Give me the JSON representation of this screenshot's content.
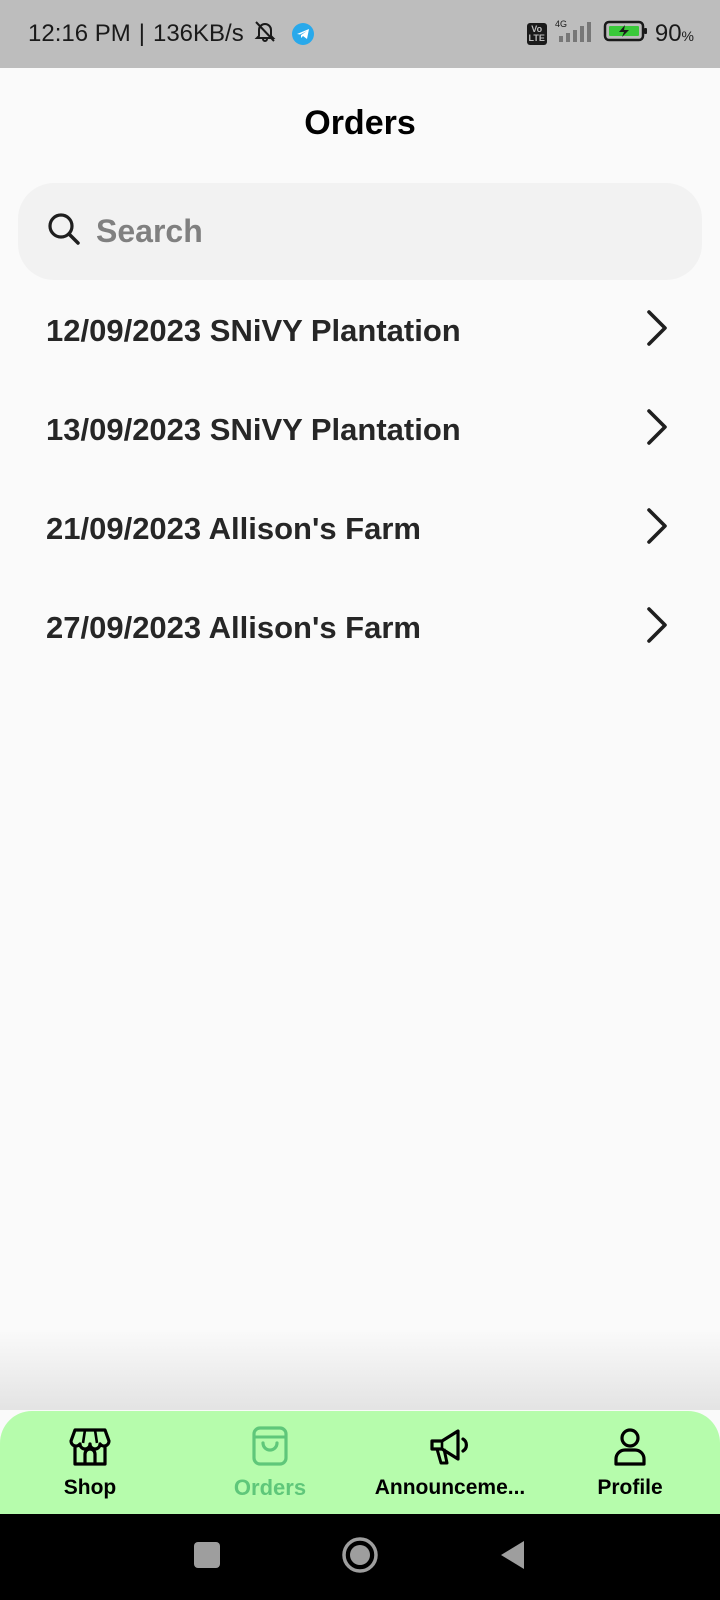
{
  "status_bar": {
    "time": "12:16 PM",
    "speed": "136KB/s",
    "network": "4G",
    "volte": "Vo\nLTE",
    "battery_percent": "90",
    "battery_unit": "%"
  },
  "header": {
    "title": "Orders"
  },
  "search": {
    "placeholder": "Search",
    "value": ""
  },
  "orders": [
    {
      "label": "12/09/2023 SNiVY Plantation"
    },
    {
      "label": "13/09/2023 SNiVY Plantation"
    },
    {
      "label": "21/09/2023 Allison's Farm"
    },
    {
      "label": "27/09/2023 Allison's Farm"
    }
  ],
  "bottom_nav": {
    "items": [
      {
        "label": "Shop",
        "icon": "shop-icon",
        "active": false
      },
      {
        "label": "Orders",
        "icon": "shopping-bag-icon",
        "active": true
      },
      {
        "label": "Announceme...",
        "icon": "megaphone-icon",
        "active": false
      },
      {
        "label": "Profile",
        "icon": "user-icon",
        "active": false
      }
    ]
  },
  "colors": {
    "nav_background": "#b6fcac",
    "nav_active": "#5fc77a",
    "status_bar": "#bdbdbd",
    "telegram": "#29a9eb",
    "battery": "#3ac93a"
  }
}
